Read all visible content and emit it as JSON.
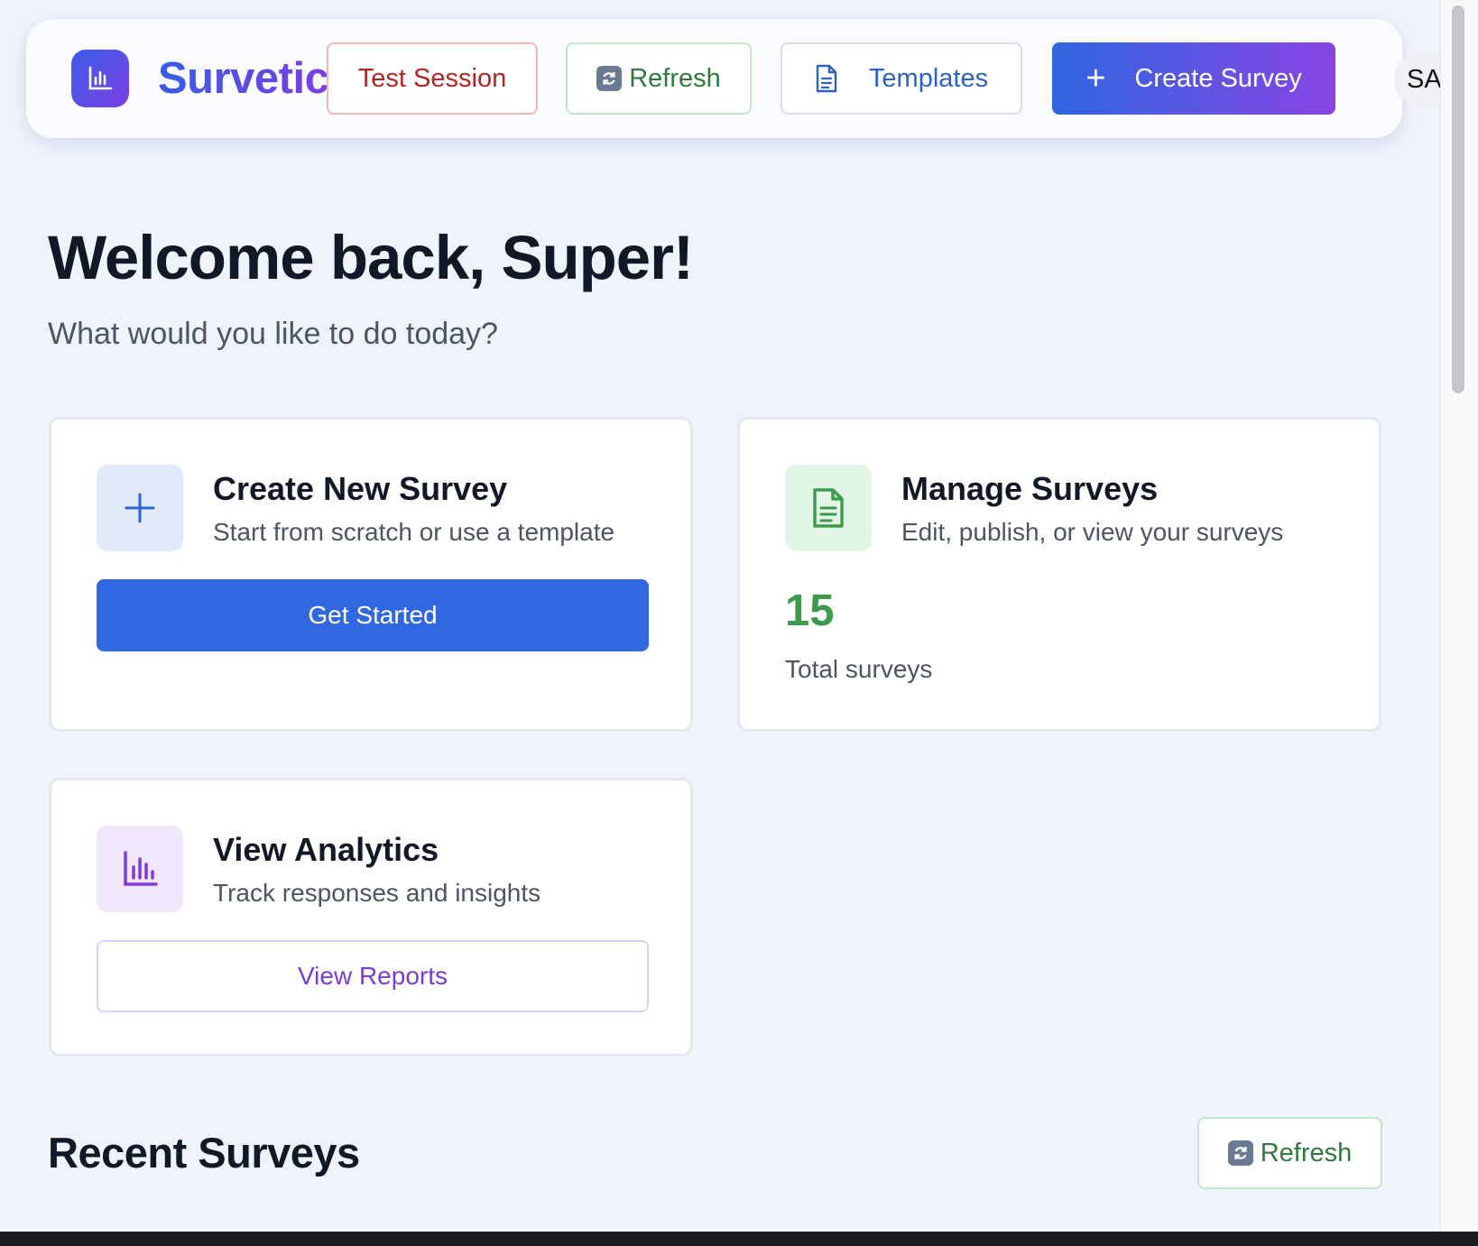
{
  "header": {
    "brand": "Survetic",
    "buttons": {
      "test_session": "Test Session",
      "refresh": "Refresh",
      "templates": "Templates",
      "create_survey": "Create Survey"
    },
    "avatar_initials": "SA"
  },
  "welcome": {
    "title": "Welcome back, Super!",
    "subtitle": "What would you like to do today?"
  },
  "cards": {
    "create": {
      "icon": "plus-icon",
      "title": "Create New Survey",
      "description": "Start from scratch or use a template",
      "button": "Get Started"
    },
    "manage": {
      "icon": "document-icon",
      "title": "Manage Surveys",
      "description": "Edit, publish, or view your surveys",
      "stat_value": "15",
      "stat_label": "Total surveys"
    },
    "analytics": {
      "icon": "bar-chart-icon",
      "title": "View Analytics",
      "description": "Track responses and insights",
      "button": "View Reports"
    }
  },
  "recent": {
    "title": "Recent Surveys",
    "refresh_label": "Refresh"
  },
  "colors": {
    "background": "#eef3fc",
    "primary_blue": "#3168e2",
    "brand_gradient_start": "#3a5be6",
    "brand_gradient_end": "#7a3fe2",
    "danger_red": "#b42424",
    "success_green": "#2e7a3c",
    "stat_green": "#3e9a4c",
    "analytics_purple": "#7c3ad6"
  }
}
